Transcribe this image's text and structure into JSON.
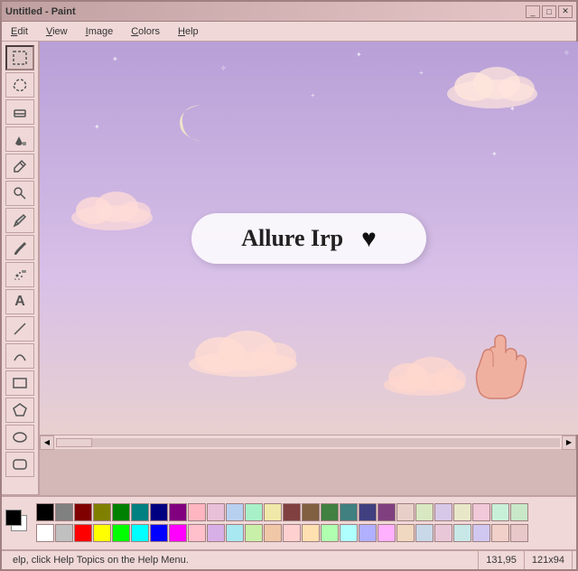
{
  "window": {
    "title": "Untitled - Paint",
    "minimize_label": "_",
    "maximize_label": "□",
    "close_label": "✕"
  },
  "menu": {
    "items": [
      {
        "id": "edit",
        "label": "Edit",
        "underline_index": 0
      },
      {
        "id": "view",
        "label": "View",
        "underline_index": 0
      },
      {
        "id": "image",
        "label": "Image",
        "underline_index": 0
      },
      {
        "id": "colors",
        "label": "Colors",
        "underline_index": 0
      },
      {
        "id": "help",
        "label": "Help",
        "underline_index": 0
      }
    ]
  },
  "toolbar": {
    "tools": [
      {
        "id": "select-rect",
        "icon": "▭",
        "label": "Select"
      },
      {
        "id": "select-free",
        "icon": "⬡",
        "label": "Free Select"
      },
      {
        "id": "eraser",
        "icon": "◻",
        "label": "Eraser"
      },
      {
        "id": "fill",
        "icon": "⬛",
        "label": "Fill"
      },
      {
        "id": "pick-color",
        "icon": "✎",
        "label": "Pick Color"
      },
      {
        "id": "zoom",
        "icon": "🔍",
        "label": "Zoom"
      },
      {
        "id": "pencil",
        "icon": "✏",
        "label": "Pencil"
      },
      {
        "id": "brush",
        "icon": "🖌",
        "label": "Brush"
      },
      {
        "id": "airbrush",
        "icon": "⬤",
        "label": "Airbrush"
      },
      {
        "id": "text",
        "icon": "A",
        "label": "Text"
      },
      {
        "id": "line",
        "icon": "╱",
        "label": "Line"
      },
      {
        "id": "curve",
        "icon": "⌒",
        "label": "Curve"
      },
      {
        "id": "rect",
        "icon": "▭",
        "label": "Rectangle"
      },
      {
        "id": "polygon",
        "icon": "⬠",
        "label": "Polygon"
      },
      {
        "id": "ellipse",
        "icon": "⬭",
        "label": "Ellipse"
      },
      {
        "id": "rounded-rect",
        "icon": "▢",
        "label": "Rounded Rect"
      }
    ]
  },
  "canvas": {
    "painting": {
      "title": "Allure Irp",
      "heart": "♥",
      "badge_bg": "rgba(255,255,255,0.85)"
    }
  },
  "palette": {
    "colors": [
      "#000000",
      "#808080",
      "#800000",
      "#808000",
      "#008000",
      "#008080",
      "#000080",
      "#800080",
      "#808040",
      "#004040",
      "#0080FF",
      "#004080",
      "#8000FF",
      "#804000",
      "#FFFFFF",
      "#C0C0C0",
      "#FF0000",
      "#FFFF00",
      "#00FF00",
      "#00FFFF",
      "#0000FF",
      "#FF00FF",
      "#FFFF80",
      "#00FF80",
      "#80FFFF",
      "#8080FF",
      "#FF0080",
      "#FF8040",
      "#FFB6C1",
      "#FFD700",
      "#98FB98",
      "#87CEEB",
      "#DDA0DD",
      "#F0E68C",
      "#90EE90",
      "#ADD8E6",
      "#FFB3DE",
      "#C8A8E8",
      "#E8C0D0",
      "#D0E8C0",
      "#FFC0CB",
      "#FFDAB9",
      "#E6E6FA",
      "#B0E0E6",
      "#EE82EE",
      "#98FF98",
      "#FFFACD",
      "#87CEFA"
    ]
  },
  "status": {
    "help_text": "elp, click Help Topics on the Help Menu.",
    "coordinates": "131,95",
    "dimensions": "121x94"
  }
}
